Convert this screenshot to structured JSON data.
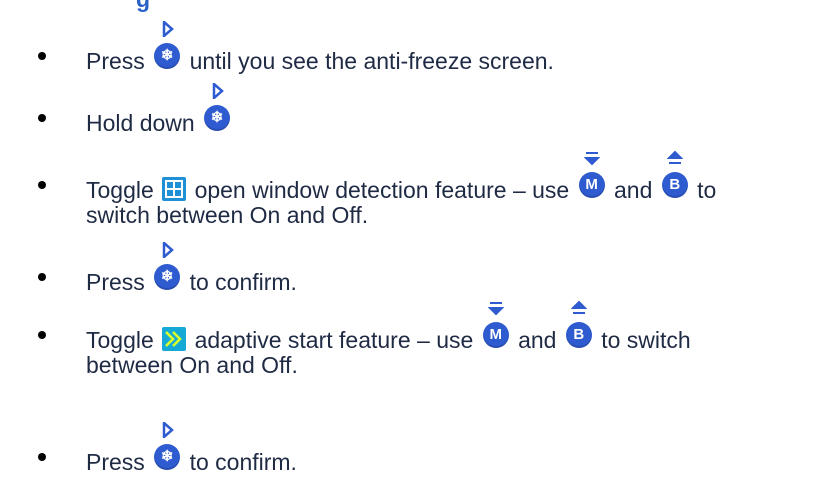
{
  "heading_fragment": "g",
  "items": [
    {
      "before": "Press",
      "after": " until you see the anti-freeze screen."
    },
    {
      "before": "Hold down",
      "after": ""
    },
    {
      "before": "Toggle",
      "middle1": " open window detection feature – use ",
      "middle2": " and ",
      "after": " to",
      "continuation": "switch between On and Off."
    },
    {
      "before": "Press",
      "after": " to confirm."
    },
    {
      "before": "Toggle",
      "middle1": " adaptive start feature – use ",
      "middle2": " and ",
      "after": " to switch",
      "continuation": "between On and Off."
    },
    {
      "before": "Press",
      "after": " to confirm."
    }
  ],
  "buttons": {
    "mode_letter": "M",
    "back_letter": "B",
    "snowflake_glyph": "❄"
  },
  "icons": {
    "ok_button": "snowflake-ok-button-icon",
    "window_detection": "open-window-detection-icon",
    "adaptive_start": "adaptive-start-icon",
    "mode_down": "m-down-button-icon",
    "back_up": "b-up-button-icon"
  },
  "colors": {
    "text": "#1f2a44",
    "button_blue": "#2f5bd0",
    "heading_blue": "#2a61c7"
  }
}
